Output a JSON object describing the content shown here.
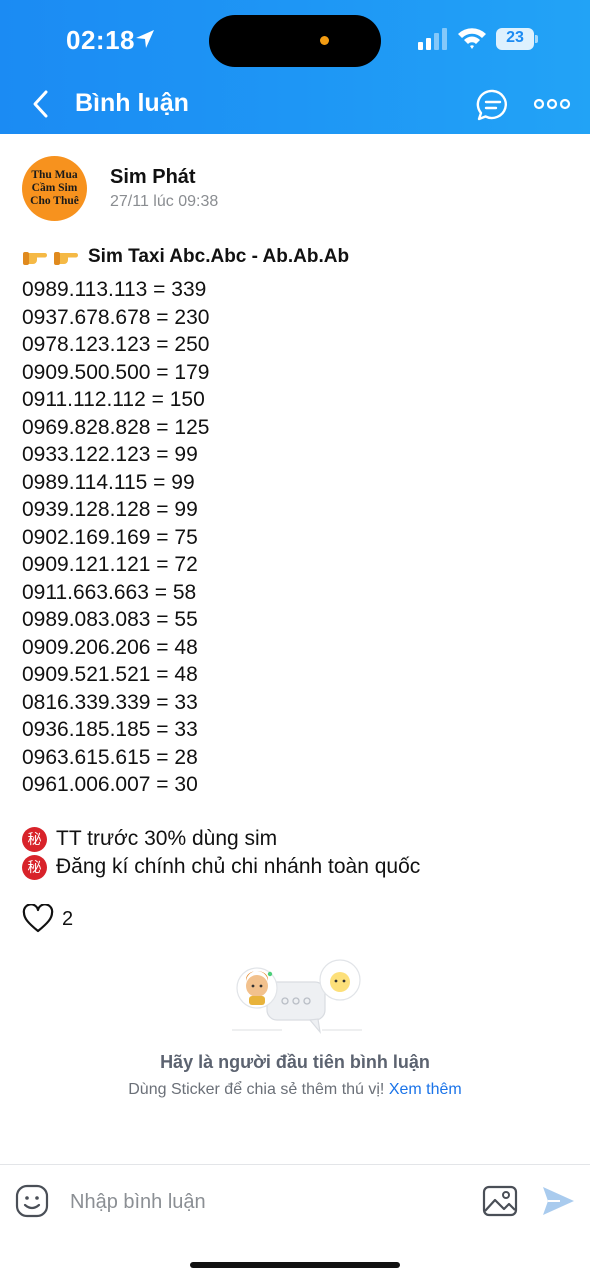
{
  "status_bar": {
    "time": "02:18",
    "battery": "23"
  },
  "nav": {
    "title": "Bình luận",
    "icons": [
      "back-chevron-icon",
      "chat-bubble-icon",
      "more-dots-icon"
    ]
  },
  "post": {
    "avatar_text": [
      "Thu Mua",
      "Cầm Sim",
      "Cho Thuê"
    ],
    "author": "Sim Phát",
    "time": "27/11 lúc 09:38",
    "title": "Sim Taxi Abc.Abc - Ab.Ab.Ab",
    "sims": [
      "0989.113.113 = 339",
      "0937.678.678 = 230",
      "0978.123.123 = 250",
      "0909.500.500 = 179",
      "0911.112.112 = 150",
      "0969.828.828 = 125",
      "0933.122.123 = 99",
      "0989.114.115 = 99",
      "0939.128.128 = 99",
      "0902.169.169 = 75",
      "0909.121.121 = 72",
      "0911.663.663 = 58",
      "0989.083.083 = 55",
      "0909.206.206 = 48",
      "0909.521.521 = 48",
      "0816.339.339 = 33",
      "0936.185.185 = 33",
      "0963.615.615 = 28",
      "0961.006.007 = 30"
    ],
    "notes": [
      "TT trước 30% dùng sim",
      "Đăng kí chính chủ chi nhánh toàn quốc"
    ],
    "note_icon_char": "秘",
    "likes": "2"
  },
  "empty_state": {
    "title": "Hãy là người đầu tiên bình luận",
    "subtitle": "Dùng Sticker để chia sẻ thêm thú vị!",
    "link": "Xem thêm"
  },
  "composer": {
    "placeholder": "Nhập bình luận"
  },
  "colors": {
    "header": "#1e96f5",
    "accent": "#1a73e8",
    "secret_badge": "#d8232a",
    "avatar_bg": "#f7921e"
  }
}
